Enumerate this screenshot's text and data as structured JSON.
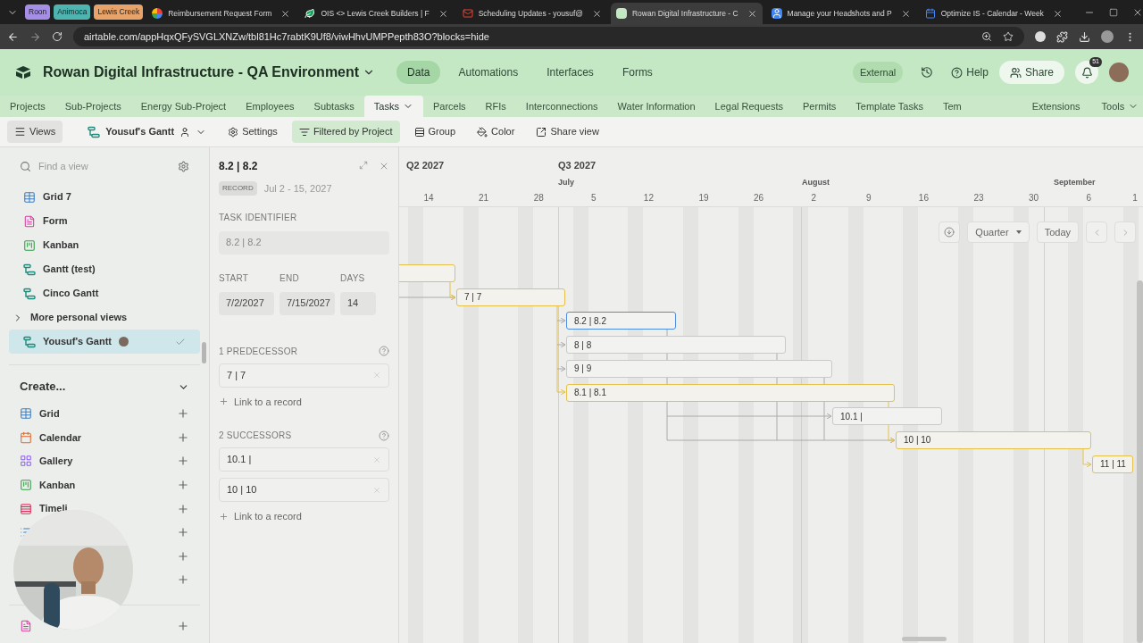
{
  "browser": {
    "tab_groups": [
      {
        "label": "Roon",
        "color": "#a58ee6"
      },
      {
        "label": "Animoca",
        "color": "#4fb3b0"
      },
      {
        "label": "Lewis Creek",
        "color": "#e8a36a"
      }
    ],
    "tabs": [
      {
        "title": "Reimbursement Request Form",
        "kind": "pinwheel",
        "selected": false
      },
      {
        "title": "OIS <> Lewis Creek Builders | F",
        "kind": "leaf",
        "selected": false
      },
      {
        "title": "Scheduling Updates - yousuf@",
        "kind": "mail",
        "selected": false
      },
      {
        "title": "Rowan Digital Infrastructure - C",
        "kind": "base",
        "selected": true
      },
      {
        "title": "Manage your Headshots and P",
        "kind": "person",
        "selected": false
      },
      {
        "title": "Optimize IS - Calendar - Week",
        "kind": "calendar",
        "selected": false
      }
    ],
    "url": "airtable.com/appHqxQFySVGLXNZw/tbl81Hc7rabtK9Uf8/viwHhvUMPPepth83O?blocks=hide"
  },
  "header": {
    "title": "Rowan Digital Infrastructure - QA Environment",
    "nav": [
      {
        "label": "Data",
        "selected": true
      },
      {
        "label": "Automations",
        "selected": false
      },
      {
        "label": "Interfaces",
        "selected": false
      },
      {
        "label": "Forms",
        "selected": false
      }
    ],
    "external": "External",
    "help": "Help",
    "share": "Share",
    "notifications": "51"
  },
  "table_tabs": [
    {
      "label": "Projects",
      "selected": false
    },
    {
      "label": "Sub-Projects",
      "selected": false
    },
    {
      "label": "Energy Sub-Project",
      "selected": false
    },
    {
      "label": "Employees",
      "selected": false
    },
    {
      "label": "Subtasks",
      "selected": false
    },
    {
      "label": "Tasks",
      "selected": true
    },
    {
      "label": "Parcels",
      "selected": false
    },
    {
      "label": "RFIs",
      "selected": false
    },
    {
      "label": "Interconnections",
      "selected": false
    },
    {
      "label": "Water Information",
      "selected": false
    },
    {
      "label": "Legal Requests",
      "selected": false
    },
    {
      "label": "Permits",
      "selected": false
    },
    {
      "label": "Template Tasks",
      "selected": false
    },
    {
      "label": "Tem",
      "selected": false
    }
  ],
  "table_tools": [
    "Extensions",
    "Tools"
  ],
  "toolbar": {
    "views": "Views",
    "view_name": "Yousuf's Gantt",
    "settings": "Settings",
    "filter": {
      "label": "Filtered by Project",
      "on": true
    },
    "group": "Group",
    "color_label": "Color",
    "share_view": "Share view"
  },
  "sidebar": {
    "search_placeholder": "Find a view",
    "views": [
      {
        "label": "Grid 7",
        "kind": "grid",
        "selected": false
      },
      {
        "label": "Form",
        "kind": "form",
        "selected": false
      },
      {
        "label": "Kanban",
        "kind": "kanban",
        "selected": false
      },
      {
        "label": "Gantt (test)",
        "kind": "gantt",
        "selected": false
      },
      {
        "label": "Cinco Gantt",
        "kind": "gantt",
        "selected": false
      }
    ],
    "more_label": "More personal views",
    "personal_views": [
      {
        "label": "Yousuf's Gantt",
        "kind": "gantt",
        "selected": true
      }
    ],
    "create_title": "Create...",
    "create": [
      {
        "label": "Grid",
        "kind": "grid"
      },
      {
        "label": "Calendar",
        "kind": "calendar"
      },
      {
        "label": "Gallery",
        "kind": "gallery"
      },
      {
        "label": "Kanban",
        "kind": "kanban"
      },
      {
        "label": "Timeli",
        "kind": "timeline"
      },
      {
        "kind": "list"
      },
      {
        "kind": "none"
      },
      {
        "kind": "none"
      },
      {
        "kind": "form"
      }
    ]
  },
  "detail": {
    "title": "8.2 | 8.2",
    "badge": "RECORD",
    "dates": "Jul 2 - 15, 2027",
    "identifier": {
      "label": "TASK IDENTIFIER",
      "value": "8.2 | 8.2"
    },
    "start": {
      "label": "START",
      "value": "7/2/2027"
    },
    "end": {
      "label": "END",
      "value": "7/15/2027"
    },
    "days": {
      "label": "DAYS",
      "value": "14"
    },
    "predecessors": {
      "label": "1 PREDECESSOR",
      "items": [
        "7 | 7"
      ],
      "link": "Link to a record"
    },
    "successors": {
      "label": "2 SUCCESSORS",
      "items": [
        "10.1 |",
        "10 | 10"
      ],
      "link": "Link to a record"
    }
  },
  "gantt": {
    "quarters": [
      "Q2 2027",
      "Q3 2027"
    ],
    "months": [
      "July",
      "August",
      "September"
    ],
    "weeks": [
      "14",
      "21",
      "28",
      "5",
      "12",
      "19",
      "26",
      "2",
      "9",
      "16",
      "23",
      "30",
      "6",
      "1"
    ],
    "scale": "Quarter",
    "today": "Today",
    "bars": [
      {
        "kind": "critical",
        "selected": false
      },
      {
        "label": "7 | 7",
        "kind": "critical",
        "selected": false
      },
      {
        "label": "8.2 | 8.2",
        "kind": "normal",
        "selected": true
      },
      {
        "label": "8 | 8",
        "kind": "normal",
        "selected": false
      },
      {
        "label": "9 | 9",
        "kind": "normal",
        "selected": false
      },
      {
        "label": "8.1 | 8.1",
        "kind": "critical",
        "selected": false
      },
      {
        "label": "10.1 |",
        "kind": "normal",
        "selected": false
      },
      {
        "label": "10 | 10",
        "kind": "critical",
        "selected": false
      },
      {
        "label": "11 | 11",
        "kind": "critical",
        "selected": false
      }
    ]
  }
}
